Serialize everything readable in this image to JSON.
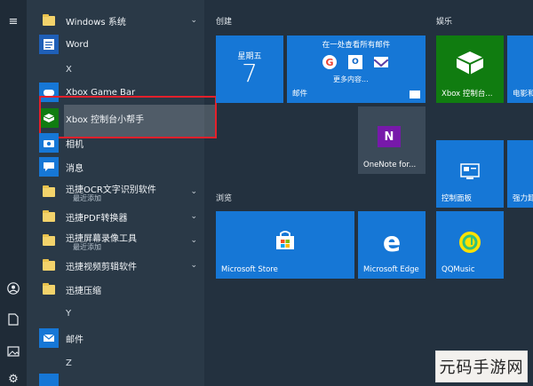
{
  "applist": {
    "windows_system": "Windows 系统",
    "word": "Word",
    "letter_x": "X",
    "xbox_game_bar": "Xbox Game Bar",
    "xbox_console": "Xbox 控制台小帮手",
    "camera": "相机",
    "messages": "消息",
    "ocr": "迅捷OCR文字识别软件",
    "ocr_sub": "最近添加",
    "pdf": "迅捷PDF转换器",
    "recorder": "迅捷屏幕录像工具",
    "recorder_sub": "最近添加",
    "video": "迅捷视频剪辑软件",
    "zip": "迅捷压缩",
    "letter_y": "Y",
    "mail": "邮件",
    "letter_z": "Z"
  },
  "sections": {
    "create": "创建",
    "entertainment": "娱乐",
    "browse": "浏览"
  },
  "tiles": {
    "calendar_day": "星期五",
    "calendar_date": "7",
    "mail_header": "在一处查看所有邮件",
    "mail_more": "更多内容...",
    "mail_label": "邮件",
    "onenote": "OneNote for...",
    "xbox_console": "Xbox 控制台...",
    "movies": "电影和",
    "control_panel": "控制面板",
    "capture": "强力卸",
    "store": "Microsoft Store",
    "edge": "Microsoft Edge",
    "qqmusic": "QQMusic"
  },
  "watermark": "元码手游网",
  "colors": {
    "accent_blue": "#1677d6",
    "xbox_green": "#107c10",
    "red_box": "#e5202b"
  }
}
